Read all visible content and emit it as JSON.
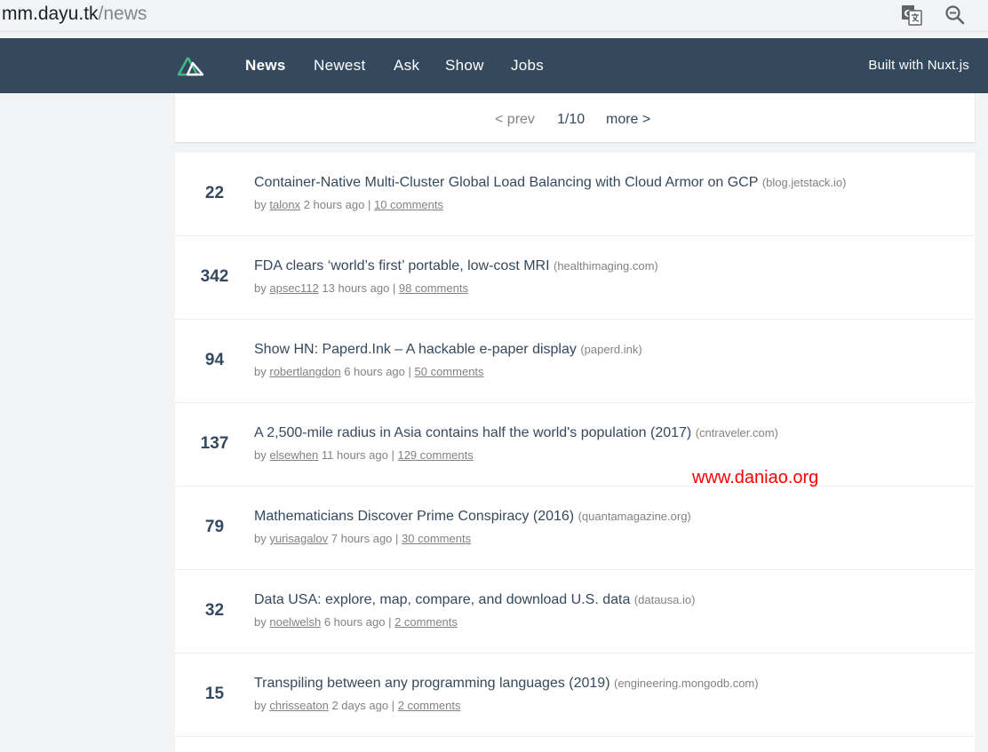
{
  "browser": {
    "url_host": "mm.dayu.tk",
    "url_path": "/news",
    "icons": [
      "translate-icon",
      "zoom-icon"
    ]
  },
  "header": {
    "logo": "nuxt-logo-icon",
    "nav": [
      {
        "label": "News",
        "active": true
      },
      {
        "label": "Newest",
        "active": false
      },
      {
        "label": "Ask",
        "active": false
      },
      {
        "label": "Show",
        "active": false
      },
      {
        "label": "Jobs",
        "active": false
      }
    ],
    "built_with": "Built with Nuxt.js",
    "background": "#35495e"
  },
  "pagination": {
    "prev": "< prev",
    "count": "1/10",
    "more": "more >"
  },
  "items": [
    {
      "score": "22",
      "title": "Container-Native Multi-Cluster Global Load Balancing with Cloud Armor on GCP",
      "host": "(blog.jetstack.io)",
      "by": "by",
      "user": "talonx",
      "time": "2 hours ago |",
      "comments": "10 comments"
    },
    {
      "score": "342",
      "title": "FDA clears ‘world’s first’ portable, low-cost MRI",
      "host": "(healthimaging.com)",
      "by": "by",
      "user": "apsec112",
      "time": "13 hours ago |",
      "comments": "98 comments"
    },
    {
      "score": "94",
      "title": "Show HN: Paperd.Ink – A hackable e-paper display",
      "host": "(paperd.ink)",
      "by": "by",
      "user": "robertlangdon",
      "time": "6 hours ago |",
      "comments": "50 comments"
    },
    {
      "score": "137",
      "title": "A 2,500-mile radius in Asia contains half the world's population (2017)",
      "host": "(cntraveler.com)",
      "by": "by",
      "user": "elsewhen",
      "time": "11 hours ago |",
      "comments": "129 comments"
    },
    {
      "score": "79",
      "title": "Mathematicians Discover Prime Conspiracy (2016)",
      "host": "(quantamagazine.org)",
      "by": "by",
      "user": "yurisagalov",
      "time": "7 hours ago |",
      "comments": "30 comments"
    },
    {
      "score": "32",
      "title": "Data USA: explore, map, compare, and download U.S. data",
      "host": "(datausa.io)",
      "by": "by",
      "user": "noelwelsh",
      "time": "6 hours ago |",
      "comments": "2 comments"
    },
    {
      "score": "15",
      "title": "Transpiling between any programming languages (2019)",
      "host": "(engineering.mongodb.com)",
      "by": "by",
      "user": "chrisseaton",
      "time": "2 days ago |",
      "comments": "2 comments"
    }
  ],
  "watermark": "www.daniao.org",
  "colors": {
    "accent": "#41b883",
    "text": "#34495e",
    "muted": "#828282",
    "watermark": "#ff0000"
  }
}
